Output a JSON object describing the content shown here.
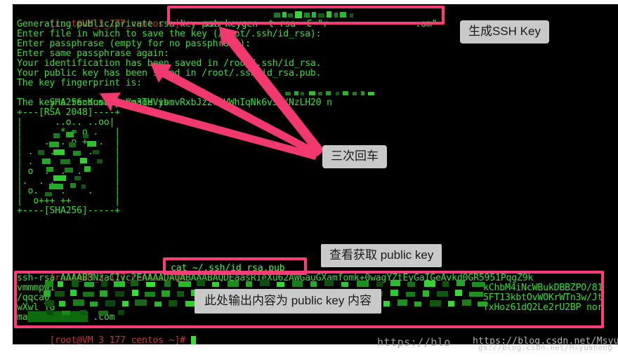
{
  "window": {
    "type": "terminal",
    "background": "#000000",
    "foreground": "#33e033"
  },
  "terminal": {
    "prompt": "[root@VM_3_177_centos ~]#",
    "prompt_user": "root",
    "prompt_host": "VM_3_177_centos",
    "prompt_path": "~",
    "lines": [
      {
        "id": "l1",
        "type": "prompt-command",
        "prompt": "[root@VM_3_177_centos ~]#",
        "command": "ssh-keygen -t rsa -C \"r■■■■■■■■■■ :om\"",
        "redacted": true
      },
      {
        "id": "l2",
        "type": "output",
        "text": "Generating public/private rsa key pair."
      },
      {
        "id": "l3",
        "type": "output",
        "text": "Enter file in which to save the key (/root/.ssh/id_rsa):"
      },
      {
        "id": "l4",
        "type": "output",
        "text": "Enter passphrase (empty for no passphrase):"
      },
      {
        "id": "l5",
        "type": "output",
        "text": "Enter same passphrase again:"
      },
      {
        "id": "l6",
        "type": "output",
        "text": "Your identification has been saved in /root/.ssh/id_rsa."
      },
      {
        "id": "l7",
        "type": "output",
        "text": "Your public key has been saved in /root/.ssh/id_rsa.pub."
      },
      {
        "id": "l8",
        "type": "output",
        "text": "The key fingerprint is:"
      },
      {
        "id": "l9",
        "type": "output",
        "text": "SHA256:KusL8juVg3THVybmvRxbJz2r1VWhIqNk6v5o/NzLH20 n■■ ■■ ■■■ ■■■ ■n",
        "redacted": true
      },
      {
        "id": "l10",
        "type": "output",
        "text": "The key's randomart image is:"
      },
      {
        "id": "l11",
        "type": "output",
        "text": "+---[RSA 2048]----+"
      },
      {
        "id": "l12",
        "type": "output",
        "text": "|      ..o.. ..oo|"
      },
      {
        "id": "l13",
        "type": "output",
        "text": "|       * = o .   |"
      },
      {
        "id": "l14",
        "type": "output",
        "text": "|    .  . o +  .  |"
      },
      {
        "id": "l15",
        "type": "output",
        "text": "| .   .      .    |"
      },
      {
        "id": "l16",
        "type": "output",
        "text": "| .  .   .        |"
      },
      {
        "id": "l17",
        "type": "output",
        "text": "| o  .  .  .      |"
      },
      {
        "id": "l18",
        "type": "output",
        "text": "|.  . .           |"
      },
      {
        "id": "l19",
        "type": "output",
        "text": "| o.    .    .    |"
      },
      {
        "id": "l20",
        "type": "output",
        "text": "|  o+++ ++        |"
      },
      {
        "id": "l21",
        "type": "output",
        "text": "+----[SHA256]-----+"
      },
      {
        "id": "l22",
        "type": "prompt-command",
        "prompt": "[root@VM_3_177_centos ~]#",
        "command": "cat ~/.ssh/id_rsa.pub"
      },
      {
        "id": "l23",
        "type": "output",
        "text": "ssh-rsa AAAAB3NzaC1yc2EAAAADAQABAAABAQDEaasR1eXu62AWGauGXamfomk+0wagYZtEyGaIGeAvkd0GR5951PqgZ9k"
      },
      {
        "id": "l24",
        "type": "output",
        "text": "vmmmpwi■■■■■■■■■■■■■■■■■■■■■■kChbM4iNcWBukDBBZPO/81",
        "redacted": true,
        "tail": "kChbM4iNcWBukDBBZPO/81",
        "head": "vmmmpwi"
      },
      {
        "id": "l25",
        "type": "output",
        "text": "/qqca0■■■■■■■■■■■■■■■■■■■■■■5FT13kbtOvWOKrWTn3w/Jt",
        "redacted": true,
        "tail": "5FT13kbtOvWOKrWTn3w/Jt",
        "head": "/qqca0"
      },
      {
        "id": "l26",
        "type": "output",
        "text": "wXwl TG■■■■■■■■■■■■■■■■■■■■fxHoz61dQ2Le2rU2BP nor",
        "redacted": true,
        "tail": "fxHoz61dQ2Le2rU2BP nor",
        "head": "wXwl TG"
      },
      {
        "id": "l27",
        "type": "output",
        "text": "ma■■■■■■■■■■■■■■ .com",
        "redacted": true
      },
      {
        "id": "l28",
        "type": "prompt-command",
        "prompt": "[root@VM_3_177_centos ~]#",
        "command": "",
        "cursor": true
      }
    ]
  },
  "annotations": {
    "accent_color": "#ff3c78",
    "label_bg": "#c9c9c9",
    "label_fg": "#1a1a1a",
    "highlights": [
      {
        "id": "hl-keygen-cmd",
        "name": "highlight-ssh-keygen-command"
      },
      {
        "id": "hl-cat-cmd",
        "name": "highlight-cat-command"
      },
      {
        "id": "hl-pubkey",
        "name": "highlight-public-key-output"
      }
    ],
    "labels": [
      {
        "id": "lbl-generate",
        "text": "生成SSH Key"
      },
      {
        "id": "lbl-enter",
        "text": "三次回车"
      },
      {
        "id": "lbl-view",
        "text": "查看获取 public key"
      },
      {
        "id": "lbl-content",
        "text": "此处输出内容为 public key 内容"
      }
    ],
    "arrows": [
      {
        "id": "arrow-1",
        "name": "arrow-to-enter-passphrase-line"
      },
      {
        "id": "arrow-2",
        "name": "arrow-to-identification-saved-line"
      },
      {
        "id": "arrow-3",
        "name": "arrow-to-key-fingerprint-line"
      }
    ]
  },
  "watermark": {
    "line1": "https://blo",
    "line2": "https://blog.csdn.net/Msyusheng",
    "line3": "gs://blog.csdn.net/Msyusheng"
  }
}
